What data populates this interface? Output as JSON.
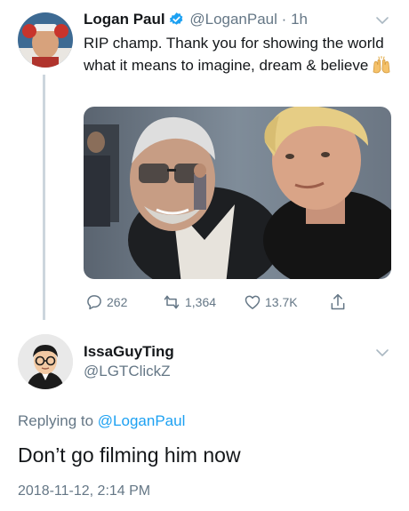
{
  "tweet1": {
    "display_name": "Logan Paul",
    "handle": "@LoganPaul",
    "separator": "·",
    "time": "1h",
    "text": "RIP champ. Thank you for showing the world what it means to imagine, dream & believe",
    "emoji": "raising-hands",
    "stats": {
      "replies": "262",
      "retweets": "1,364",
      "likes": "13.7K"
    },
    "icons": [
      "reply-icon",
      "retweet-icon",
      "like-icon",
      "share-icon"
    ]
  },
  "tweet2": {
    "display_name": "IssaGuyTing",
    "handle": "@LGTClickZ",
    "replying_prefix": "Replying to",
    "replying_to": "@LoganPaul",
    "text": "Don’t go filming him now",
    "timestamp": "2018-11-12, 2:14 PM"
  },
  "colors": {
    "link": "#1da1f2",
    "muted": "#657786",
    "text": "#14171a",
    "verified": "#1da1f2"
  }
}
